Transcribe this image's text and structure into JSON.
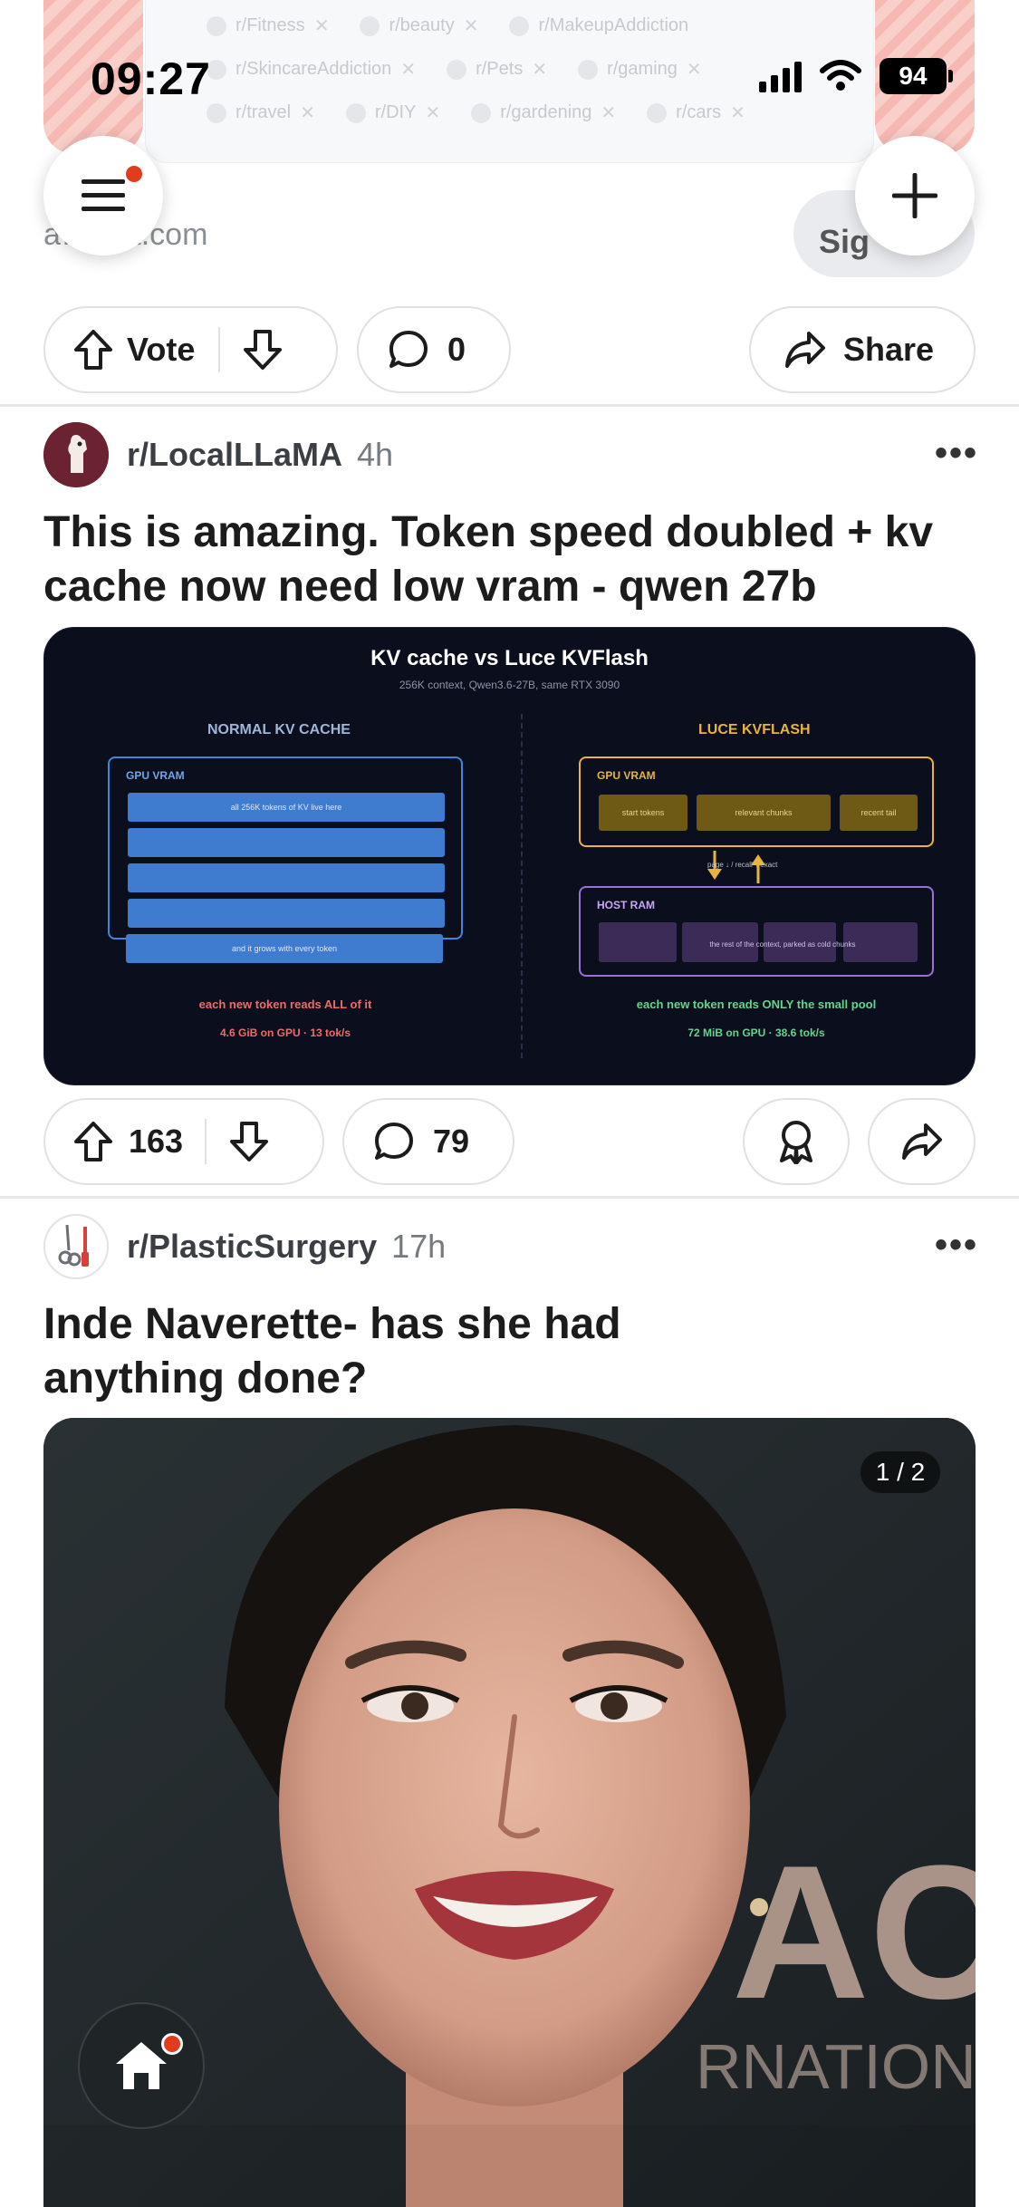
{
  "status_bar": {
    "time": "09:27",
    "battery": "94"
  },
  "ad": {
    "chips_row1": [
      "r/Fitness",
      "r/beauty",
      "r/MakeupAddiction"
    ],
    "chips_row2": [
      "r/SkincareAddiction",
      "r/Pets",
      "r/gaming"
    ],
    "chips_row3": [
      "r/travel",
      "r/DIY",
      "r/gardening",
      "r/cars"
    ],
    "url": "a…ddit.com",
    "sign_label": "Sig"
  },
  "top_actions": {
    "vote_label": "Vote",
    "comments": "0",
    "share_label": "Share"
  },
  "posts": [
    {
      "subreddit": "r/LocalLLaMA",
      "age": "4h",
      "title": "This is amazing. Token speed doubled + kv cache now need low vram - qwen 27b",
      "image": {
        "title": "KV cache vs Luce KVFlash",
        "subtitle": "256K context, Qwen3.6-27B, same RTX 3090",
        "left_heading": "NORMAL KV CACHE",
        "right_heading": "LUCE KVFLASH",
        "gpu_vram": "GPU VRAM",
        "host_ram": "HOST RAM",
        "bar_top": "all 256K tokens of KV live here",
        "bar_bottom": "and it grows with every token",
        "chip_start": "start tokens",
        "chip_relevant": "relevant chunks",
        "chip_recent": "recent tail",
        "arrow_label": "page ↓ / recall ↑ exact",
        "host_text": "the rest of the context, parked as cold chunks",
        "left_note": "each new token reads ALL of it",
        "left_stat": "4.6 GiB on GPU  ·  13 tok/s",
        "right_note": "each new token reads ONLY the small pool",
        "right_stat": "72 MiB on GPU  ·  38.6 tok/s"
      },
      "votes": "163",
      "comments": "79"
    },
    {
      "subreddit": "r/PlasticSurgery",
      "age": "17h",
      "title": "Inde Naverette- has she had anything done?",
      "image_counter": "1 / 2",
      "backdrop_text_1": "AC",
      "backdrop_text_2": "RNATIONAL"
    }
  ],
  "colors": {
    "accent": "#e23b1d",
    "gold": "#e8b43a",
    "blue": "#3f7cd0",
    "purple": "#9a6fd6",
    "red_note": "#f06a6a",
    "green_note": "#63d58a"
  }
}
